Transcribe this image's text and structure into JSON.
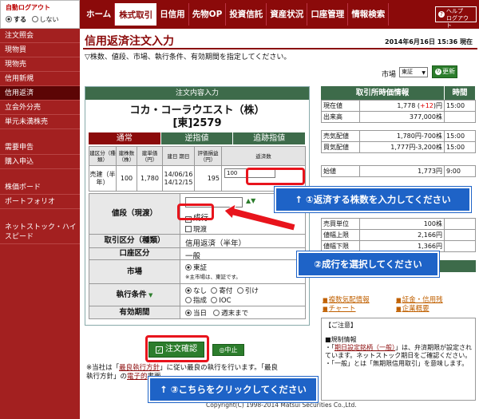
{
  "header": {
    "auto_logout_title": "自動ログアウト",
    "auto_logout_on": "する",
    "auto_logout_off": "しない",
    "tabs": [
      "ホーム",
      "株式取引",
      "日信用",
      "先物OP",
      "投資信託",
      "資産状況",
      "口座管理",
      "情報検索"
    ],
    "active_tab": "株式取引",
    "help_label_1": "ヘルプ",
    "help_label_2": "ログアウト"
  },
  "sidebar": {
    "items": [
      "注文照会",
      "現物買",
      "現物売",
      "信用新規",
      "信用返済",
      "立会外分売",
      "単元未満株売"
    ],
    "active_item": "信用返済",
    "items2": [
      "需要申告",
      "購入申込"
    ],
    "items3": [
      "株価ボード",
      "ポートフォリオ"
    ],
    "item_tall": "ネットストック・ハイスピード"
  },
  "page": {
    "title": "信用返済注文入力",
    "timestamp": "2014年6月16日 15:36 現在",
    "instruction": "▽株数、値段、市場、執行条件、有効期間を指定してください。",
    "market_label": "市場",
    "market_value": "東証",
    "update_label": "更新"
  },
  "order": {
    "header": "注文内容入力",
    "stock_name": "コカ・コーラウエスト（株）",
    "stock_code": "[東]2579",
    "tabs": [
      "通常",
      "逆指値",
      "追跡指値"
    ],
    "position_headers": [
      "建区分（種類）",
      "建株数（株）",
      "建単価（円）",
      "建日 期日",
      "評価損益（円）",
      "返済数"
    ],
    "position_row": {
      "type": "売建（半年）",
      "shares": "100",
      "price": "1,780",
      "open_date": "14/06/16",
      "due_date": "14/12/15",
      "pnl": "195",
      "qty_input": "100"
    },
    "price_label": "値段（現渡）",
    "price_market_option": "成行",
    "price_delivery_option": "現渡",
    "updown_symbol": "▲▼",
    "trade_type_label": "取引区分（種類）",
    "trade_type_value": "信用返済（半年）",
    "account_label": "口座区分",
    "account_value": "一般",
    "market_label": "市場",
    "market_value": "東証",
    "market_note": "※主市場は、東証です。",
    "condition_label": "執行条件",
    "conditions": [
      "なし",
      "寄付",
      "引け",
      "指成",
      "IOC"
    ],
    "validity_label": "有効期間",
    "validity_options": [
      "当日",
      "週末まで"
    ],
    "confirm_label": "注文確認",
    "cancel_label": "中止",
    "footnote_1": "※当社は「",
    "footnote_link_1": "最良執行方針",
    "footnote_2": "」に従い最良の執行を行います。「最良",
    "footnote_3": "執行方針」の",
    "footnote_link_2": "電子的",
    "footnote_4": "書面"
  },
  "quote": {
    "header": "取引所時価情報",
    "time_header": "時間",
    "rows": [
      {
        "label": "現在値",
        "value": "1,778",
        "change": "+12",
        "time": "15:00"
      },
      {
        "label": "出来高",
        "value": "377,000株",
        "time": ""
      },
      {
        "label": "売気配値",
        "value": "1,780円-700株",
        "time": "15:00"
      },
      {
        "label": "買気配値",
        "value": "1,777円-3,200株",
        "time": "15:00"
      },
      {
        "label": "始値",
        "value": "1,773円",
        "time": "9:00"
      },
      {
        "label": "売買単位",
        "value": "100株",
        "time": ""
      },
      {
        "label": "値幅上限",
        "value": "2,166円",
        "time": ""
      },
      {
        "label": "値幅下限",
        "value": "1,366円",
        "time": ""
      }
    ],
    "detail_header": "詳細情報",
    "detail_links": [
      "複数気配情報",
      "証金・信用残",
      "チャート",
      "企業概要"
    ]
  },
  "notice": {
    "title": "【ご注意】",
    "line_1": "■規制情報",
    "line_2": "・「",
    "line_2_link": "期日設定銘柄（一般）",
    "line_3": "」は、弁済期限が設定されています。ネットストック期日をご確認ください。",
    "line_4": "・「一般」とは「無期限信用取引」を意味します。"
  },
  "annotations": {
    "callout_1": "↑ ①返済する株数を入力してください",
    "callout_2": "②成行を選択してください",
    "callout_3": "↑ ③こちらをクリックしてください"
  },
  "copyright": "Copyright(C) 1998-2014 Matsui Securities Co.,Ltd.",
  "colors": {
    "brand": "#8b0a0a",
    "green": "#3d6b4a",
    "annotation_red": "#e8141c",
    "annotation_blue": "#1e63c7"
  }
}
